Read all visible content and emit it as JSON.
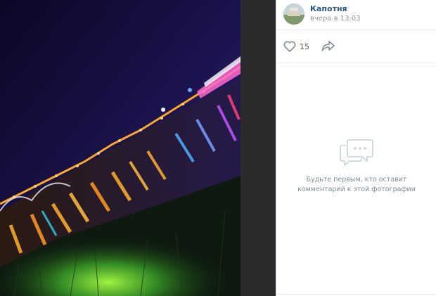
{
  "post": {
    "author": "Капотня",
    "time": "вчера в 13:03"
  },
  "actions": {
    "like_icon": "heart-icon",
    "likes_count": "15",
    "share_icon": "share-arrow-icon"
  },
  "comments": {
    "icon": "comment-bubbles-icon",
    "empty_text": "Будьте первым, кто оставит комментарий к этой фотографии"
  },
  "colors": {
    "link": "#2a5885",
    "muted": "#939393",
    "divider": "#e7e8ec",
    "viewer_gap": "#2b2b2d"
  }
}
